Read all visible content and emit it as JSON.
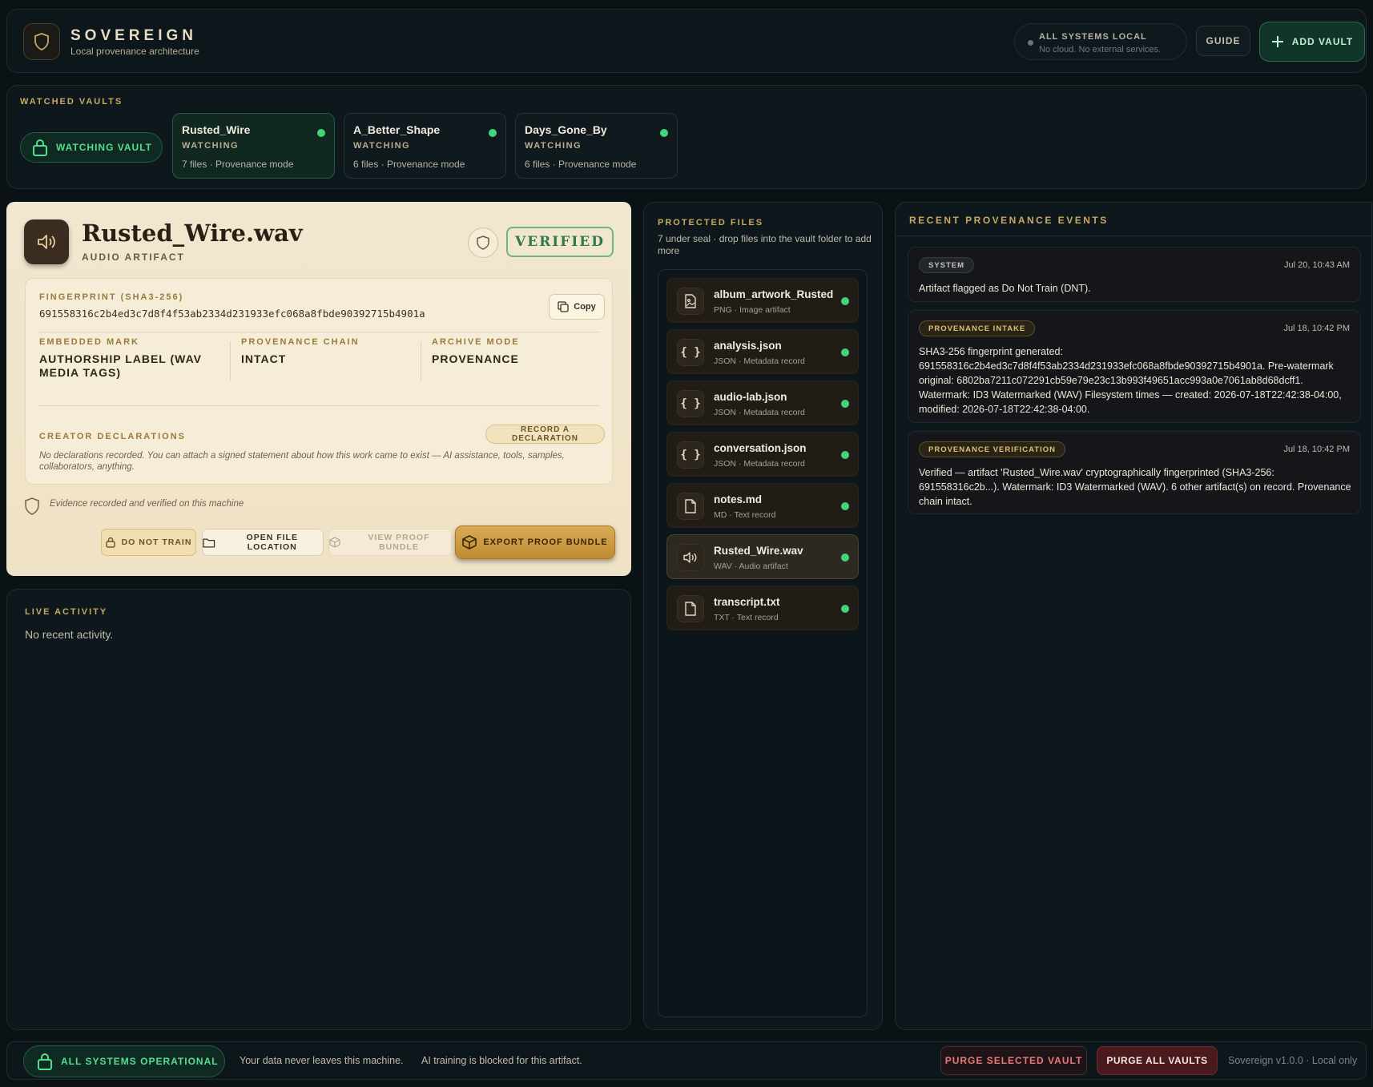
{
  "header": {
    "brand_name": "SOVEREIGN",
    "brand_sub": "Local provenance architecture",
    "logo_icon": "shield-icon",
    "status_title": "ALL SYSTEMS LOCAL",
    "status_sub": "No cloud. No external services.",
    "guide_label": "GUIDE",
    "add_vault_label": "ADD VAULT"
  },
  "vaults": {
    "title": "WATCHED VAULTS",
    "watching_label": "WATCHING VAULT",
    "items": [
      {
        "name": "Rusted_Wire",
        "status": "WATCHING",
        "meta": "7 files · Provenance mode",
        "active": true
      },
      {
        "name": "A_Better_Shape",
        "status": "WATCHING",
        "meta": "6 files · Provenance mode",
        "active": false
      },
      {
        "name": "Days_Gone_By",
        "status": "WATCHING",
        "meta": "6 files · Provenance mode",
        "active": false
      }
    ]
  },
  "artifact": {
    "title": "Rusted_Wire.wav",
    "type": "AUDIO ARTIFACT",
    "verified_label": "VERIFIED",
    "fingerprint_label": "FINGERPRINT (SHA3-256)",
    "fingerprint": "691558316c2b4ed3c7d8f4f53ab2334d231933efc068a8fbde90392715b4901a",
    "copy_label": "Copy",
    "embedded_mark_label": "EMBEDDED MARK",
    "embedded_mark_value": "AUTHORSHIP LABEL (WAV MEDIA TAGS)",
    "chain_label": "PROVENANCE CHAIN",
    "chain_value": "INTACT",
    "archive_label": "ARCHIVE MODE",
    "archive_value": "PROVENANCE",
    "declarations_label": "CREATOR DECLARATIONS",
    "record_declaration_label": "RECORD A DECLARATION",
    "declarations_text": "No declarations recorded. You can attach a signed statement about how this work came to exist — AI assistance, tools, samples, collaborators, anything.",
    "evidence_text": "Evidence recorded and verified on this machine",
    "dnt_label": "DO NOT TRAIN",
    "open_location_label": "OPEN FILE LOCATION",
    "view_proof_label": "VIEW PROOF BUNDLE",
    "export_proof_label": "EXPORT PROOF BUNDLE"
  },
  "live": {
    "title": "LIVE ACTIVITY",
    "empty": "No recent activity."
  },
  "protected": {
    "title": "PROTECTED FILES",
    "subtitle": "7 under seal · drop files into the vault folder to add more",
    "files": [
      {
        "name": "album_artwork_Rusted",
        "meta": "PNG · Image artifact",
        "icon": "image-file-icon",
        "selected": false
      },
      {
        "name": "analysis.json",
        "meta": "JSON · Metadata record",
        "icon": "json-braces-icon",
        "selected": false
      },
      {
        "name": "audio-lab.json",
        "meta": "JSON · Metadata record",
        "icon": "json-braces-icon",
        "selected": false
      },
      {
        "name": "conversation.json",
        "meta": "JSON · Metadata record",
        "icon": "json-braces-icon",
        "selected": false
      },
      {
        "name": "notes.md",
        "meta": "MD · Text record",
        "icon": "document-icon",
        "selected": false
      },
      {
        "name": "Rusted_Wire.wav",
        "meta": "WAV · Audio artifact",
        "icon": "speaker-icon",
        "selected": true
      },
      {
        "name": "transcript.txt",
        "meta": "TXT · Text record",
        "icon": "document-icon",
        "selected": false
      }
    ]
  },
  "events": {
    "title": "RECENT PROVENANCE EVENTS",
    "items": [
      {
        "tag": "SYSTEM",
        "time": "Jul 20, 10:43 AM",
        "text": "Artifact flagged as Do Not Train (DNT)."
      },
      {
        "tag": "PROVENANCE INTAKE",
        "time": "Jul 18, 10:42 PM",
        "text": "SHA3-256 fingerprint generated: 691558316c2b4ed3c7d8f4f53ab2334d231933efc068a8fbde90392715b4901a. Pre-watermark original: 6802ba7211c072291cb59e79e23c13b993f49651acc993a0e7061ab8d68dcff1. Watermark: ID3 Watermarked (WAV) Filesystem times — created: 2026-07-18T22:42:38-04:00, modified: 2026-07-18T22:42:38-04:00."
      },
      {
        "tag": "PROVENANCE VERIFICATION",
        "time": "Jul 18, 10:42 PM",
        "text": "Verified — artifact 'Rusted_Wire.wav' cryptographically fingerprinted (SHA3-256: 691558316c2b...). Watermark: ID3 Watermarked (WAV). 6 other artifact(s) on record. Provenance chain intact."
      }
    ]
  },
  "footer": {
    "ops_label": "ALL SYSTEMS OPERATIONAL",
    "note1": "Your data never leaves this machine.",
    "note2": "AI training is blocked for this artifact.",
    "purge_selected_label": "PURGE SELECTED VAULT",
    "purge_all_label": "PURGE ALL VAULTS",
    "version": "Sovereign v1.0.0 · Local only"
  },
  "colors": {
    "accent_gold": "#c9a961",
    "status_green": "#3ed67a",
    "danger_red": "#e97a78",
    "background": "#0a1216",
    "card_cream": "#f1e6cf"
  }
}
